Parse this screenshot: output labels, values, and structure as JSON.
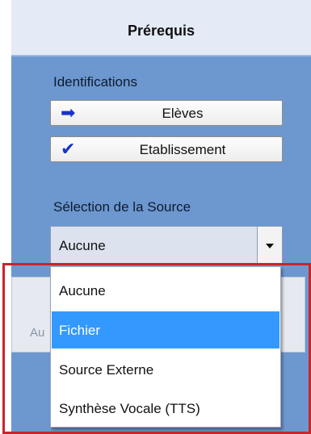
{
  "header": {
    "title": "Prérequis"
  },
  "identifications": {
    "label": "Identifications",
    "buttons": [
      {
        "label": "Elèves",
        "icon": "right-arrow-icon"
      },
      {
        "label": "Etablissement",
        "icon": "checkmark-icon"
      }
    ]
  },
  "source": {
    "label": "Sélection de la Source",
    "selected_value": "Aucune",
    "options": [
      "Aucune",
      "Fichier",
      "Source Externe",
      "Synthèse Vocale (TTS)"
    ],
    "highlighted_option": "Fichier"
  },
  "background_panel": {
    "partial_text": "Au"
  },
  "colors": {
    "panel_bg": "#6d97cf",
    "header_bg": "#e4ebf6",
    "highlight": "#3399ff",
    "annotation_outline": "#c8262a",
    "icon_blue": "#1832c8"
  }
}
